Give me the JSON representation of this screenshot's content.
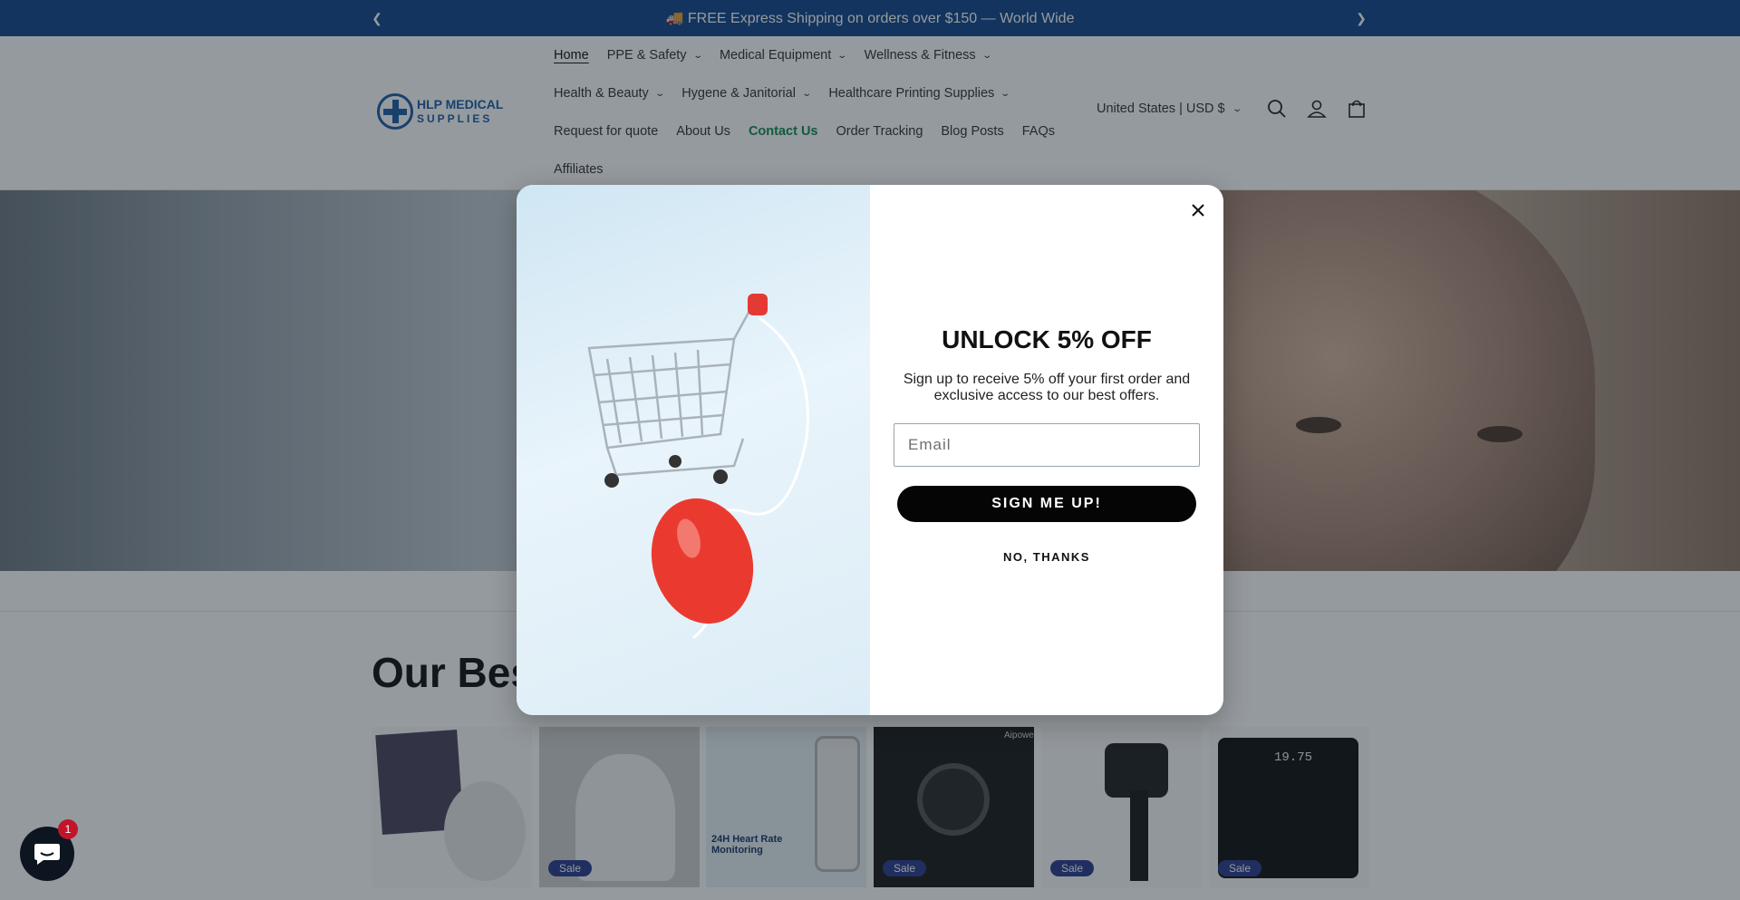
{
  "announcement": {
    "text": "🚚 FREE Express Shipping on orders over $150 — World Wide"
  },
  "logo": {
    "line1": "HLP MEDICAL",
    "line2": "SUPPLIES"
  },
  "nav": {
    "row1": [
      {
        "label": "Home",
        "active": true
      },
      {
        "label": "PPE & Safety",
        "dropdown": true
      },
      {
        "label": "Medical Equipment",
        "dropdown": true
      },
      {
        "label": "Wellness & Fitness",
        "dropdown": true
      }
    ],
    "row2": [
      {
        "label": "Health & Beauty",
        "dropdown": true
      },
      {
        "label": "Hygene & Janitorial",
        "dropdown": true
      },
      {
        "label": "Healthcare Printing Supplies",
        "dropdown": true
      }
    ],
    "row3": [
      {
        "label": "Request for quote"
      },
      {
        "label": "About Us"
      },
      {
        "label": "Contact Us",
        "highlight": true
      },
      {
        "label": "Order Tracking"
      },
      {
        "label": "Blog Posts"
      },
      {
        "label": "FAQs"
      }
    ],
    "row4": [
      {
        "label": "Affiliates"
      }
    ]
  },
  "header": {
    "country": "United States | USD $"
  },
  "section": {
    "title": "Our Best Sellers"
  },
  "products": [
    {
      "sale": ""
    },
    {
      "sale": "Sale"
    },
    {
      "sale": ""
    },
    {
      "sale": "Sale"
    },
    {
      "sale": "Sale"
    },
    {
      "sale": "Sale"
    }
  ],
  "product_captions": {
    "heart_rate": "24H Heart Rate Monitoring",
    "brand": "Aipower",
    "scale_reading": "19.75"
  },
  "popup": {
    "title": "UNLOCK 5% OFF",
    "description": "Sign up to receive 5% off your first order and exclusive access to our best offers.",
    "email_placeholder": "Email",
    "signup_label": "SIGN ME UP!",
    "decline_label": "NO, THANKS"
  },
  "chat": {
    "badge": "1"
  },
  "colors": {
    "announcement_bg": "#12468a",
    "contact_green": "#138a4f",
    "signup_bg": "#050505",
    "badge_red": "#c0152a"
  }
}
